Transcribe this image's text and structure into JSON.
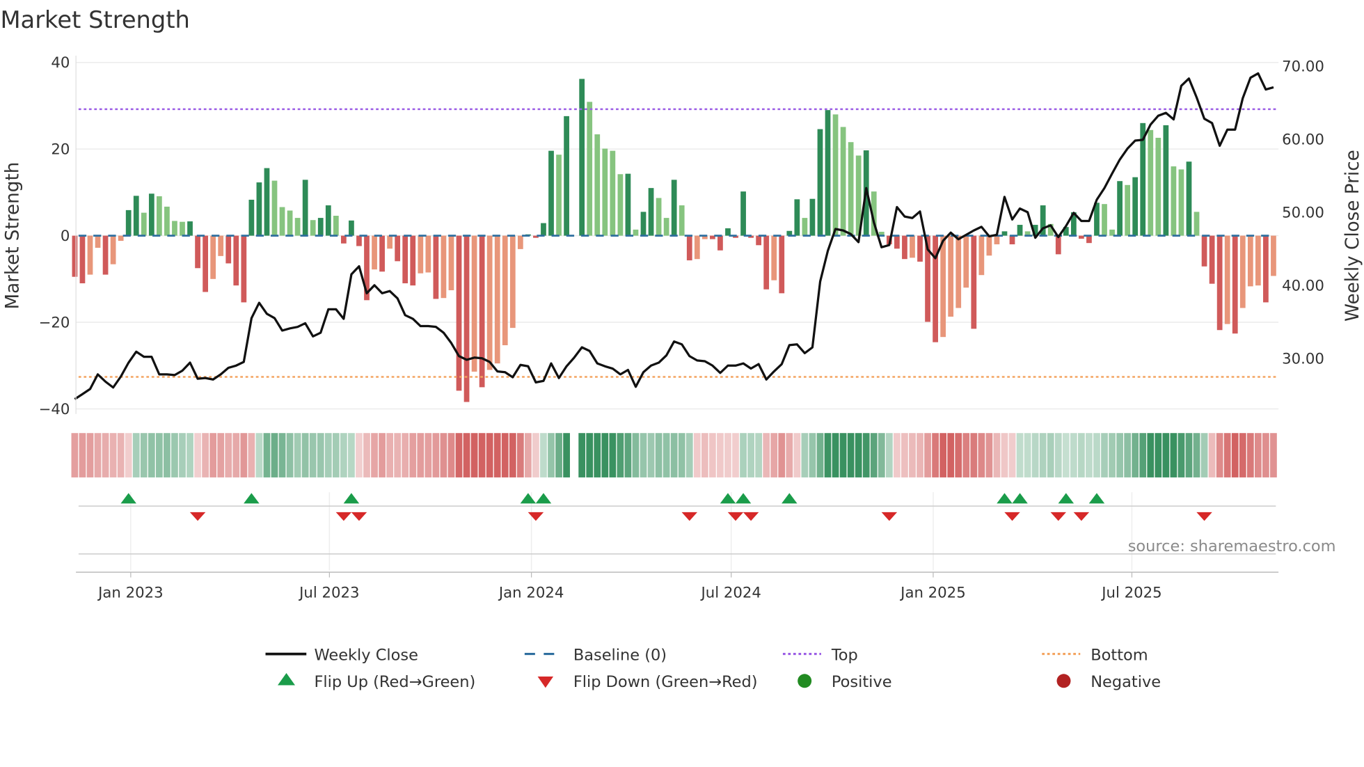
{
  "chart_data": {
    "type": "bar",
    "title": "Market Strength",
    "ylabel": "Market Strength",
    "ylabel_right": "Weekly Close Price",
    "ylim": [
      -40,
      40
    ],
    "ylim_right": [
      23,
      70.5
    ],
    "yticks": [
      "40",
      "20",
      "0",
      "−20",
      "−40"
    ],
    "yticks_values": [
      40,
      20,
      0,
      -20,
      -40
    ],
    "yticks_right": [
      "70.00",
      "60.00",
      "50.00",
      "40.00",
      "30.00"
    ],
    "yticks_right_values": [
      70,
      60,
      50,
      40,
      30
    ],
    "xticks": [
      "Jan 2023",
      "Jul 2023",
      "Jan 2024",
      "Jul 2024",
      "Jan 2025",
      "Jul 2025"
    ],
    "xticks_dates": [
      "2023-01-01",
      "2023-07-01",
      "2024-01-01",
      "2024-07-01",
      "2025-01-01",
      "2025-07-01"
    ],
    "grid": true,
    "top_level": 29.2,
    "bottom_level": -32.6,
    "baseline": 0,
    "colors": {
      "strong_positive": "#2e8b57",
      "weak_positive": "#86c47f",
      "strong_negative": "#d05a5a",
      "weak_negative": "#e8967a",
      "close": "#111111",
      "baseline": "#2f6f9f",
      "top": "#9b5de5",
      "bottom": "#f4a460",
      "flip_up": "#1a9c4a",
      "flip_down": "#d62828",
      "positive": "#228b22",
      "negative": "#b22222"
    },
    "weeks": [
      "2022-11-11",
      "2022-11-18",
      "2022-11-25",
      "2022-12-02",
      "2022-12-09",
      "2022-12-16",
      "2022-12-23",
      "2022-12-30",
      "2023-01-06",
      "2023-01-13",
      "2023-01-20",
      "2023-01-27",
      "2023-02-03",
      "2023-02-10",
      "2023-02-17",
      "2023-02-24",
      "2023-03-03",
      "2023-03-10",
      "2023-03-17",
      "2023-03-24",
      "2023-03-31",
      "2023-04-07",
      "2023-04-14",
      "2023-04-21",
      "2023-04-28",
      "2023-05-05",
      "2023-05-12",
      "2023-05-19",
      "2023-05-26",
      "2023-06-02",
      "2023-06-09",
      "2023-06-16",
      "2023-06-23",
      "2023-06-30",
      "2023-07-07",
      "2023-07-14",
      "2023-07-21",
      "2023-07-28",
      "2023-08-04",
      "2023-08-11",
      "2023-08-18",
      "2023-08-25",
      "2023-09-01",
      "2023-09-08",
      "2023-09-15",
      "2023-09-22",
      "2023-09-29",
      "2023-10-06",
      "2023-10-13",
      "2023-10-20",
      "2023-10-27",
      "2023-11-03",
      "2023-11-10",
      "2023-11-17",
      "2023-11-24",
      "2023-12-01",
      "2023-12-08",
      "2023-12-15",
      "2023-12-22",
      "2023-12-29",
      "2024-01-05",
      "2024-01-12",
      "2024-01-19",
      "2024-01-26",
      "2024-02-02",
      "2024-02-09",
      "2024-02-16",
      "2024-02-23",
      "2024-03-01",
      "2024-03-08",
      "2024-03-15",
      "2024-03-22",
      "2024-03-29",
      "2024-04-05",
      "2024-04-12",
      "2024-04-19",
      "2024-04-26",
      "2024-05-03",
      "2024-05-10",
      "2024-05-17",
      "2024-05-24",
      "2024-05-31",
      "2024-06-07",
      "2024-06-14",
      "2024-06-21",
      "2024-06-28",
      "2024-07-05",
      "2024-07-12",
      "2024-07-19",
      "2024-07-26",
      "2024-08-02",
      "2024-08-09",
      "2024-08-16",
      "2024-08-23",
      "2024-08-30",
      "2024-09-06",
      "2024-09-13",
      "2024-09-20",
      "2024-09-27",
      "2024-10-04",
      "2024-10-11",
      "2024-10-18",
      "2024-10-25",
      "2024-11-01",
      "2024-11-08",
      "2024-11-15",
      "2024-11-22",
      "2024-11-29",
      "2024-12-06",
      "2024-12-13",
      "2024-12-20",
      "2024-12-27",
      "2025-01-03",
      "2025-01-10",
      "2025-01-17",
      "2025-01-24",
      "2025-01-31",
      "2025-02-07",
      "2025-02-14",
      "2025-02-21",
      "2025-02-28",
      "2025-03-07",
      "2025-03-14",
      "2025-03-21",
      "2025-03-28",
      "2025-04-04",
      "2025-04-11",
      "2025-04-18",
      "2025-04-25",
      "2025-05-02",
      "2025-05-09",
      "2025-05-16",
      "2025-05-23",
      "2025-05-30",
      "2025-06-06",
      "2025-06-13",
      "2025-06-20",
      "2025-06-27",
      "2025-07-04",
      "2025-07-11",
      "2025-07-18",
      "2025-07-25",
      "2025-08-01",
      "2025-08-08",
      "2025-08-15",
      "2025-08-22",
      "2025-08-29",
      "2025-09-05",
      "2025-09-12",
      "2025-09-19",
      "2025-09-26",
      "2025-10-03",
      "2025-10-10",
      "2025-10-17",
      "2025-10-24",
      "2025-10-31",
      "2025-11-07"
    ],
    "strength": [
      -9.5,
      -11,
      -9,
      -2.8,
      -9,
      -6.6,
      -1.2,
      5.9,
      9.2,
      5.3,
      9.7,
      9.1,
      6.7,
      3.4,
      3.2,
      3.3,
      -7.5,
      -13,
      -10,
      -4.7,
      -6.4,
      -11.5,
      -15.4,
      8.3,
      12.3,
      15.6,
      12.7,
      6.6,
      5.8,
      4.1,
      12.9,
      3.6,
      4.1,
      7,
      4.6,
      -1.8,
      3.5,
      -2.4,
      -14.9,
      -7.8,
      -8.3,
      -3,
      -5.9,
      -11,
      -11.5,
      -8.7,
      -8.5,
      -14.6,
      -14.4,
      -12.6,
      -35.8,
      -38.4,
      -31.4,
      -35,
      -31,
      -29.5,
      -25.3,
      -21.3,
      -3.1,
      0.3,
      -0.5,
      2.9,
      19.6,
      18.7,
      27.6,
      null,
      36.2,
      30.9,
      23.4,
      20.1,
      19.6,
      14.2,
      14.3,
      1.4,
      5.5,
      11,
      8.7,
      4.1,
      12.9,
      7,
      -5.7,
      -5.4,
      -0.8,
      -0.8,
      -3.4,
      1.7,
      -0.5,
      10.2,
      -0.5,
      -2.2,
      -12.4,
      -10.3,
      -13.3,
      1.1,
      8.4,
      4.1,
      8.5,
      24.6,
      29,
      28,
      25.1,
      21.6,
      18.5,
      19.7,
      10.2,
      0.9,
      -2,
      -3,
      -5.4,
      -5.1,
      -6,
      -19.9,
      -24.6,
      -23.4,
      -18.7,
      -16.7,
      -12,
      -21.5,
      -9.1,
      -4.6,
      -2,
      1,
      -2,
      2.5,
      1,
      2.5,
      7,
      2.7,
      -4.3,
      2,
      5.4,
      -0.7,
      -1.7,
      7.6,
      7.3,
      1.4,
      12.6,
      11.7,
      13.5,
      26,
      24.4,
      22.6,
      25.5,
      16,
      15.3,
      17.1,
      5.5,
      -7.1,
      -11.1,
      -21.8,
      -20.4,
      -22.6,
      -16.7,
      -11.7,
      -11.5,
      -15.4,
      -9.3
    ],
    "weekly_close": [
      24.4,
      25.1,
      25.8,
      27.8,
      26.8,
      26,
      27.5,
      29.4,
      30.9,
      30.2,
      30.2,
      27.8,
      27.8,
      27.7,
      28.3,
      29.4,
      27.2,
      27.3,
      27.1,
      27.8,
      28.7,
      29,
      29.5,
      35.5,
      37.6,
      36.1,
      35.5,
      33.8,
      34.1,
      34.3,
      34.8,
      33,
      33.5,
      36.7,
      36.7,
      35.4,
      41.5,
      42.6,
      38.9,
      40,
      38.9,
      39.2,
      38.2,
      35.9,
      35.4,
      34.4,
      34.4,
      34.3,
      33.5,
      32.1,
      30.3,
      29.8,
      30.1,
      30,
      29.5,
      28.2,
      28.1,
      27.4,
      29.1,
      28.9,
      26.7,
      26.9,
      29.3,
      27.3,
      28.9,
      30.1,
      31.5,
      31,
      29.3,
      28.9,
      28.6,
      27.8,
      28.4,
      26.1,
      28.1,
      29,
      29.4,
      30.4,
      32.3,
      31.9,
      30.3,
      29.7,
      29.6,
      29,
      28,
      29,
      29,
      29.3,
      28.6,
      29.2,
      27.1,
      28.2,
      29.2,
      31.8,
      31.9,
      30.7,
      31.5,
      40.5,
      44.7,
      47.7,
      47.5,
      47,
      45.9,
      53.3,
      48.6,
      45.2,
      45.5,
      50.7,
      49.4,
      49.2,
      50.1,
      44.9,
      43.7,
      46.1,
      47.2,
      46.3,
      46.9,
      47.5,
      48,
      46.7,
      46.9,
      52.1,
      49,
      50.5,
      50,
      46.5,
      47.8,
      48.2,
      46.6,
      48.1,
      49.9,
      48.8,
      48.8,
      51.7,
      53.3,
      55.3,
      57.2,
      58.7,
      59.8,
      59.9,
      62,
      63.2,
      63.6,
      62.7,
      67.3,
      68.3,
      65.7,
      62.8,
      62.2,
      59.1,
      61.3,
      61.3,
      65.6,
      68.4,
      69,
      66.8,
      67.1
    ],
    "flip_up": [
      "2022-12-30",
      "2023-04-21",
      "2023-07-21",
      "2023-12-29",
      "2024-01-12",
      "2024-06-28",
      "2024-07-12",
      "2024-08-23",
      "2025-03-07",
      "2025-03-21",
      "2025-05-02",
      "2025-05-30"
    ],
    "flip_down": [
      "2023-03-03",
      "2023-07-14",
      "2023-07-28",
      "2024-01-05",
      "2024-05-24",
      "2024-07-05",
      "2024-07-19",
      "2024-11-22",
      "2025-03-14",
      "2025-04-25",
      "2025-05-16",
      "2025-09-05"
    ],
    "legend": {
      "position": "bottom",
      "items": [
        {
          "label": "Weekly Close",
          "kind": "line"
        },
        {
          "label": "Baseline (0)",
          "kind": "dash"
        },
        {
          "label": "Top",
          "kind": "dot-top"
        },
        {
          "label": "Bottom",
          "kind": "dot-bottom"
        },
        {
          "label": "Flip Up (Red→Green)",
          "kind": "tri-up"
        },
        {
          "label": "Flip Down (Green→Red)",
          "kind": "tri-down"
        },
        {
          "label": "Positive",
          "kind": "circle-pos"
        },
        {
          "label": "Negative",
          "kind": "circle-neg"
        }
      ]
    },
    "source": "source: sharemaestro.com"
  }
}
